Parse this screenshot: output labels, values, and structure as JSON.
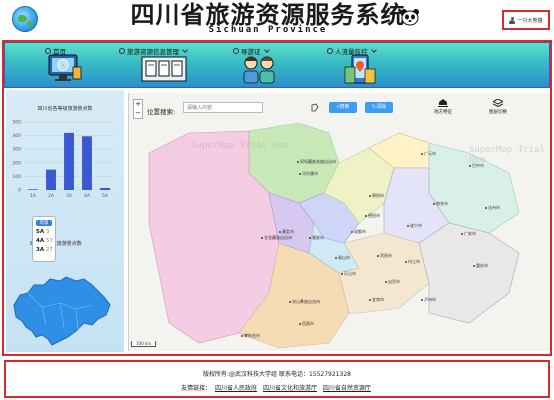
{
  "header": {
    "title": "四川省旅游资源服务系统",
    "subtitle": "Sichuan Province",
    "user_label": "一只大熊猫"
  },
  "nav": {
    "items": [
      {
        "label": "首页",
        "has_dropdown": false
      },
      {
        "label": "旅游资源信息管理",
        "has_dropdown": true
      },
      {
        "label": "导游证",
        "has_dropdown": true
      },
      {
        "label": "人流量监控",
        "has_dropdown": true
      }
    ]
  },
  "left_panel": {
    "bar_chart_title": "四川省各等级旅游景点数",
    "map_chart_title": "四川省5A级旅游景点数",
    "legend": {
      "header": "等级",
      "rows": [
        {
          "grade": "5A",
          "value": "3"
        },
        {
          "grade": "4A",
          "value": "57"
        },
        {
          "grade": "3A",
          "value": "27"
        }
      ]
    }
  },
  "chart_data": {
    "type": "bar",
    "categories": [
      "1A",
      "2A",
      "3A",
      "4A",
      "5A"
    ],
    "values": [
      5,
      150,
      420,
      395,
      15
    ],
    "ylim": [
      0,
      500
    ],
    "yticks": [
      0,
      100,
      200,
      300,
      400,
      500
    ],
    "grid": true,
    "color": "#3a58d0"
  },
  "map": {
    "location_label": "位置搜索:",
    "search_placeholder": "请输入内容",
    "search_button": "搜索",
    "clear_button": "清除",
    "layer_buttons": [
      "地方特征",
      "图层切换"
    ],
    "watermark": "SuperMap Trial Use",
    "scale": "100 km",
    "cities": [
      "阿坝藏族羌族自治州",
      "马尔康市",
      "甘孜藏族自治州",
      "康定市",
      "雅安市",
      "成都市",
      "德阳市",
      "绵阳市",
      "广元市",
      "巴中市",
      "达州市",
      "南充市",
      "广安市",
      "遂宁市",
      "资阳市",
      "内江市",
      "重庆市",
      "眉山市",
      "乐山市",
      "自贡市",
      "宜宾市",
      "泸州市",
      "凉山彝族自治州",
      "西昌市",
      "攀枝花市"
    ]
  },
  "colors": {
    "accent_red": "#d42c2c",
    "nav_top": "#5fe0c8",
    "nav_bottom": "#2a8fc9",
    "button_blue": "#3d9bf2",
    "bar_blue": "#3a58d0",
    "province_blue": "#2f8ee6"
  },
  "footer": {
    "copyright": "版权所有:@武汉科技大学组 联系电话：15527921328",
    "links_label": "友情链接：",
    "links": [
      "四川省人民政府",
      "四川省文化和旅游厅",
      "四川省自然资源厅"
    ]
  }
}
